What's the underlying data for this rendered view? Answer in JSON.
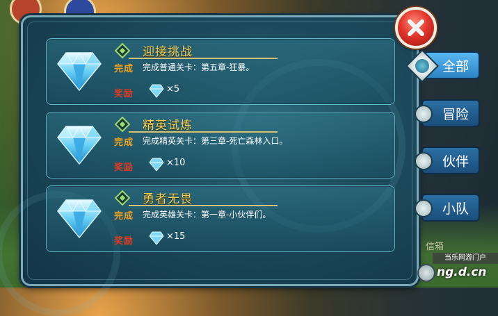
{
  "close_button": {
    "icon": "close-icon"
  },
  "cards": [
    {
      "title": "迎接挑战",
      "done_label": "完成",
      "description": "完成普通关卡：第五章-狂暴。",
      "reward_label": "奖励",
      "reward_icon": "diamond-icon",
      "reward_count": "×5"
    },
    {
      "title": "精英试炼",
      "done_label": "完成",
      "description": "完成精英关卡：第三章-死亡森林入口。",
      "reward_label": "奖励",
      "reward_icon": "diamond-icon",
      "reward_count": "×10"
    },
    {
      "title": "勇者无畏",
      "done_label": "完成",
      "description": "完成英雄关卡：第一章-小伙伴们。",
      "reward_label": "奖励",
      "reward_icon": "diamond-icon",
      "reward_count": "×15"
    }
  ],
  "tabs": [
    {
      "label": "全部",
      "active": true
    },
    {
      "label": "冒险",
      "active": false
    },
    {
      "label": "伙伴",
      "active": false
    },
    {
      "label": "小队",
      "active": false
    }
  ],
  "mailbox_label": "信箱",
  "watermark": {
    "text": "当乐网游门户",
    "domain": "ng.d.cn"
  },
  "colors": {
    "title": "#f2d35a",
    "done": "#f0a21f",
    "reward": "#e23b1f",
    "tab_active": "#3b9be0",
    "tab": "#2466a0",
    "close": "#e2352b"
  }
}
